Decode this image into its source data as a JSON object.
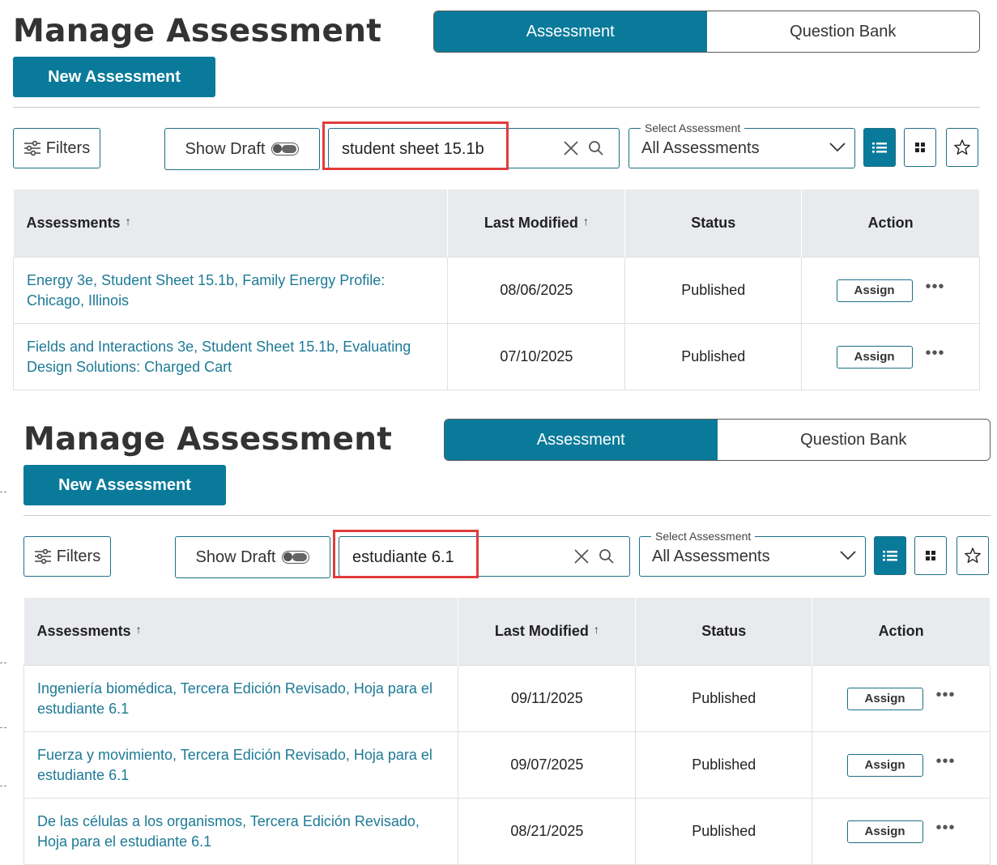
{
  "panels": [
    {
      "title": "Manage Assessment",
      "tabs": [
        {
          "label": "Assessment",
          "active": true
        },
        {
          "label": "Question Bank",
          "active": false
        }
      ],
      "new_button": "New Assessment",
      "filters_label": "Filters",
      "show_draft_label": "Show Draft",
      "search_value": "student sheet 15.1b",
      "select_legend": "Select Assessment",
      "select_value": "All Assessments",
      "columns": {
        "name": "Assessments",
        "modified": "Last Modified",
        "status": "Status",
        "action": "Action"
      },
      "rows": [
        {
          "name": "Energy 3e, Student Sheet 15.1b, Family Energy Profile: Chicago, Illinois",
          "modified": "08/06/2025",
          "status": "Published",
          "action": "Assign"
        },
        {
          "name": "Fields and Interactions 3e, Student Sheet 15.1b, Evaluating Design Solutions: Charged Cart",
          "modified": "07/10/2025",
          "status": "Published",
          "action": "Assign"
        }
      ]
    },
    {
      "title": "Manage Assessment",
      "tabs": [
        {
          "label": "Assessment",
          "active": true
        },
        {
          "label": "Question Bank",
          "active": false
        }
      ],
      "new_button": "New Assessment",
      "filters_label": "Filters",
      "show_draft_label": "Show Draft",
      "search_value": "estudiante 6.1",
      "select_legend": "Select Assessment",
      "select_value": "All Assessments",
      "columns": {
        "name": "Assessments",
        "modified": "Last Modified",
        "status": "Status",
        "action": "Action"
      },
      "rows": [
        {
          "name": "Ingeniería biomédica, Tercera Edición Revisado, Hoja para el estudiante 6.1",
          "modified": "09/11/2025",
          "status": "Published",
          "action": "Assign"
        },
        {
          "name": "Fuerza y movimiento, Tercera Edición Revisado, Hoja para el estudiante 6.1",
          "modified": "09/07/2025",
          "status": "Published",
          "action": "Assign"
        },
        {
          "name": "De las células a los organismos, Tercera Edición Revisado, Hoja para el estudiante 6.1",
          "modified": "08/21/2025",
          "status": "Published",
          "action": "Assign"
        }
      ]
    }
  ],
  "colors": {
    "accent": "#0a7a9a",
    "link": "#1d7a96",
    "highlight": "#e23b3b",
    "header_bg": "#e8eaed"
  },
  "icons": [
    "filter-sliders-icon",
    "toggle-switch",
    "clear-x-icon",
    "search-icon",
    "chevron-down-icon",
    "list-view-icon",
    "grid-view-icon",
    "star-icon",
    "more-dots-icon",
    "sort-up-arrow-icon"
  ]
}
